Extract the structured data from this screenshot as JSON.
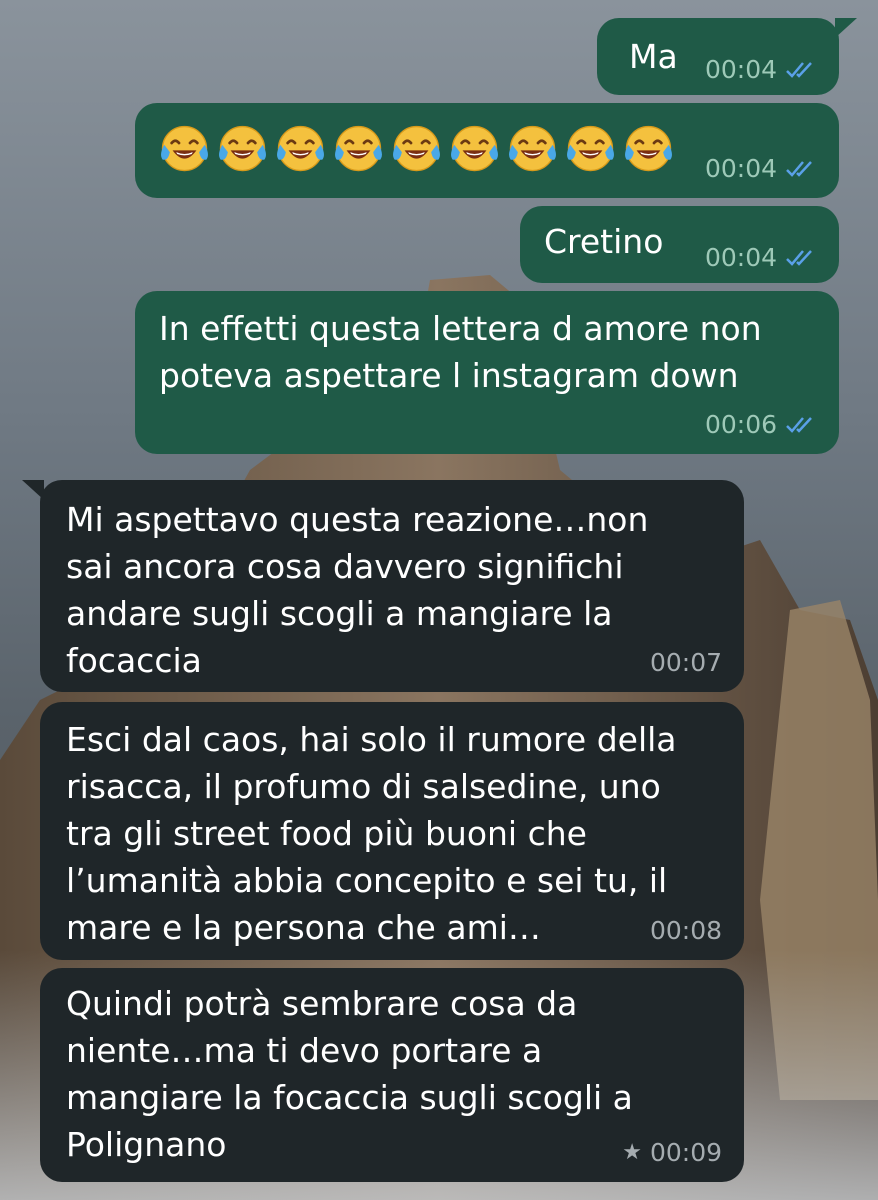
{
  "chat": {
    "messages": [
      {
        "direction": "out",
        "text": "Ma",
        "time": "00:04",
        "status": "read"
      },
      {
        "direction": "out",
        "emoji": "face-with-tears-of-joy",
        "emoji_count": 9,
        "time": "00:04",
        "status": "read"
      },
      {
        "direction": "out",
        "text": "Cretino",
        "time": "00:04",
        "status": "read"
      },
      {
        "direction": "out",
        "text": "In effetti questa lettera d amore non\npoteva aspettare l instagram down",
        "time": "00:06",
        "status": "read"
      },
      {
        "direction": "in",
        "text": "Mi aspettavo questa reazione…non\nsai ancora cosa davvero significhi\nandare sugli scogli a mangiare la\nfocaccia",
        "time": "00:07"
      },
      {
        "direction": "in",
        "text": "Esci dal caos, hai solo il rumore della\nrisacca, il profumo di salsedine, uno\ntra gli street food più buoni che\nl’umanità abbia concepito e sei tu, il\nmare e la persona che ami…",
        "time": "00:08"
      },
      {
        "direction": "in",
        "text": "Quindi potrà sembrare cosa da\nniente…ma ti devo portare a\nmangiare la focaccia sugli scogli a\nPolignano",
        "time": "00:09",
        "starred": true
      }
    ]
  },
  "colors": {
    "outgoing_bubble": "#1f5a47",
    "incoming_bubble": "#1f2629",
    "read_ticks": "#5aa0e8"
  },
  "icons": {
    "read": "double-check-icon",
    "starred": "star-icon",
    "emoji": "face-with-tears-of-joy"
  }
}
